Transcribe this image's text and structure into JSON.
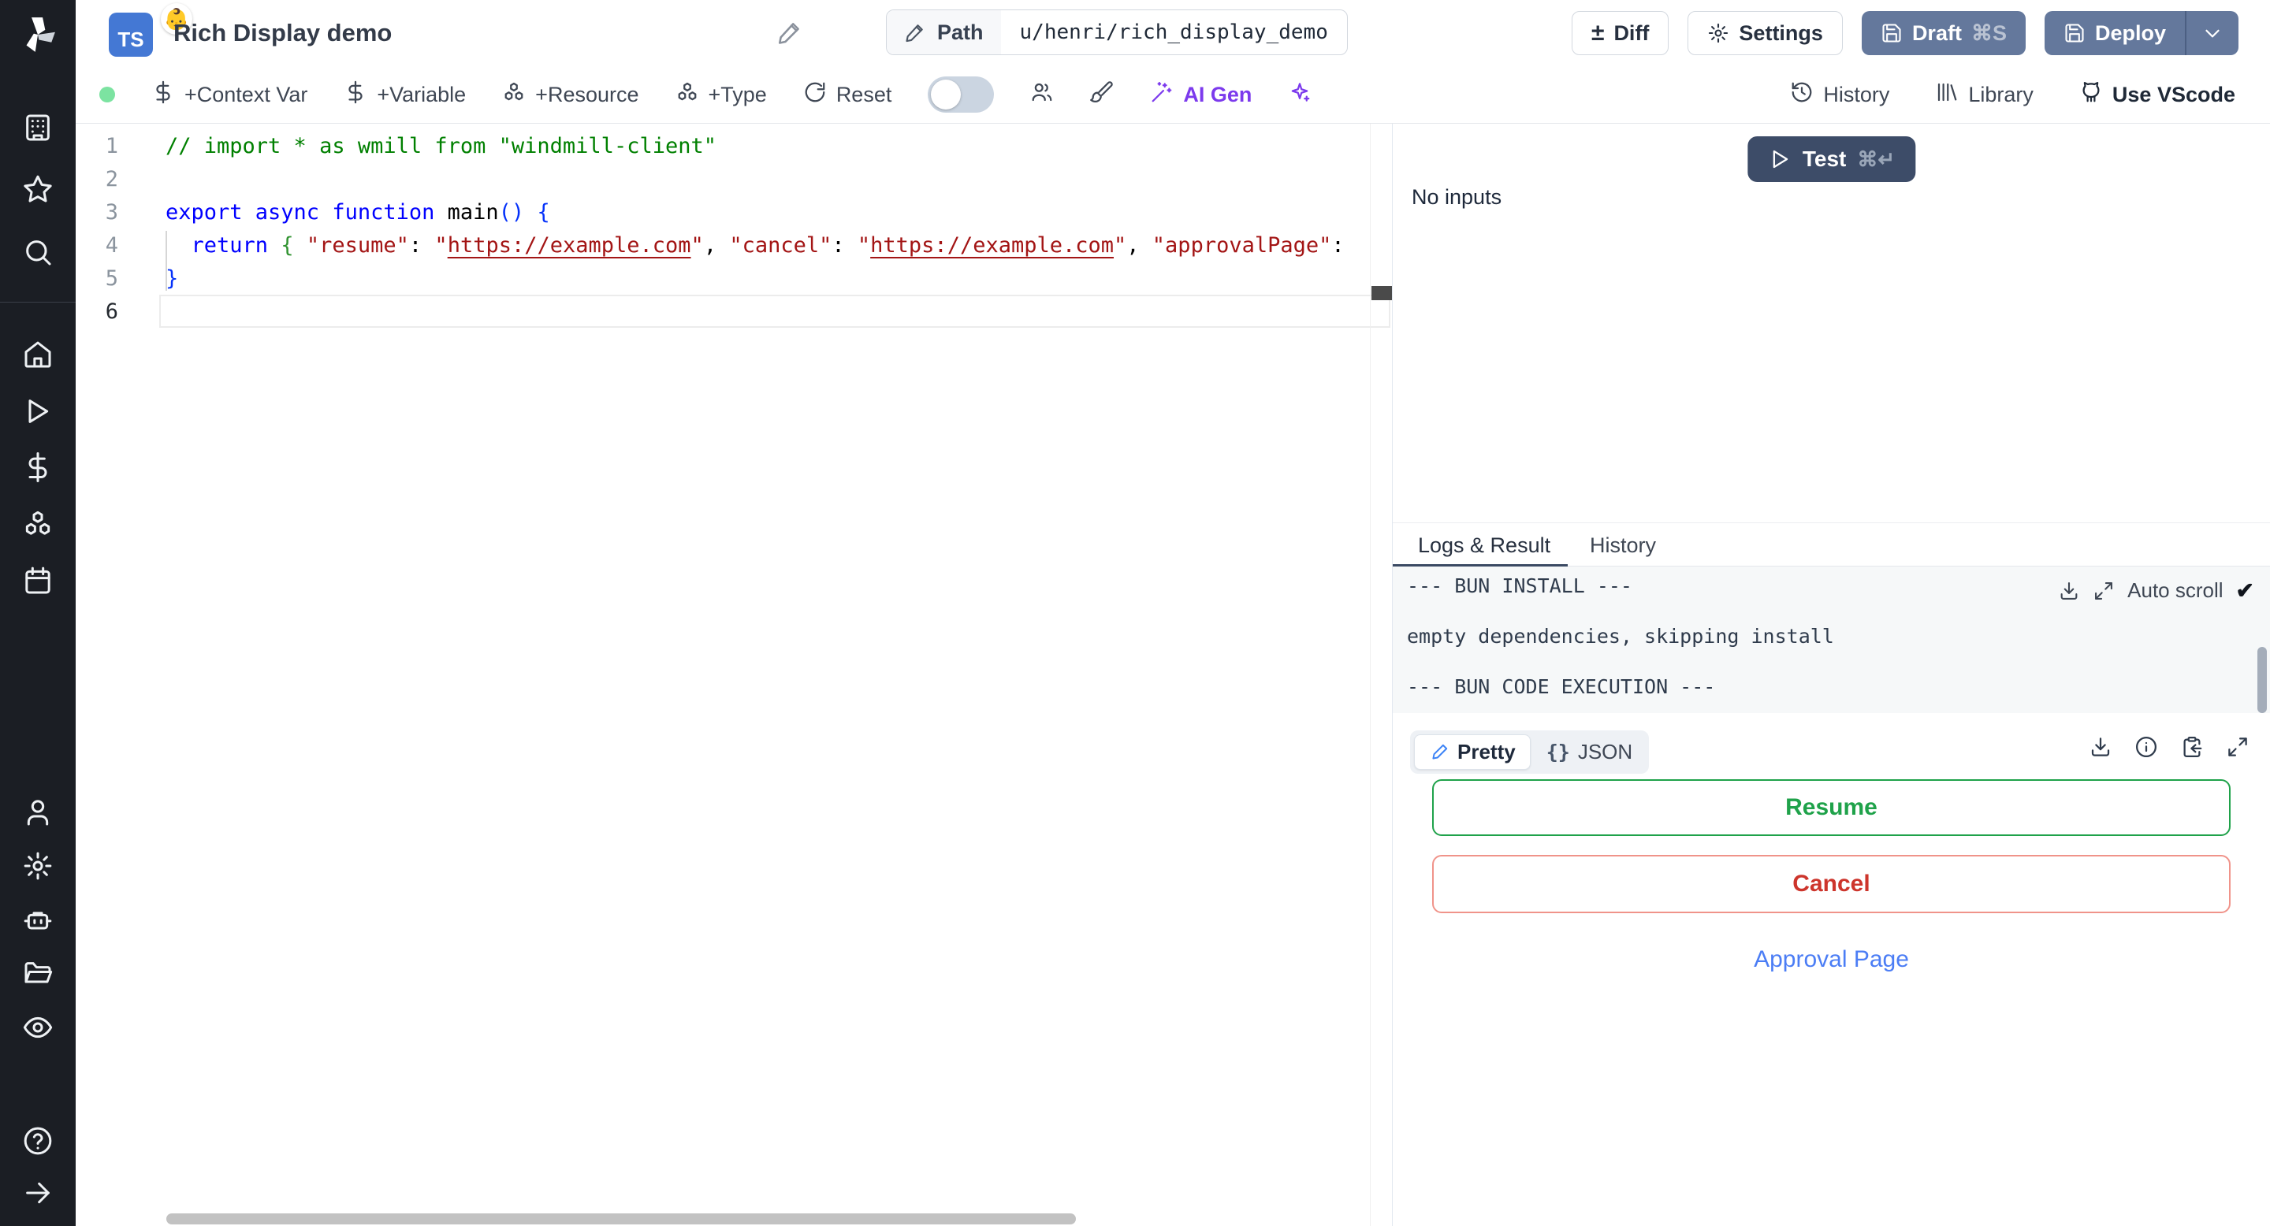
{
  "colors": {
    "accent_button": "#64789c",
    "test_button": "#3d4c68",
    "resume_green": "#1fa24a",
    "cancel_red": "#cd352c",
    "link_blue": "#4b7df5",
    "ai_purple": "#7c3aed",
    "status_dot_green": "#7ce3a1",
    "sidebar_bg": "#1b1e24",
    "ts_badge_blue": "#4478d4"
  },
  "sidebar": {
    "icons_top": [
      "building",
      "star",
      "search"
    ],
    "icons_workspace": [
      "home",
      "play",
      "dollar",
      "boxes",
      "calendar"
    ],
    "icons_admin": [
      "user",
      "settings",
      "robot",
      "folder-open",
      "eye"
    ],
    "icons_bottom": [
      "help",
      "arrow-right"
    ]
  },
  "header": {
    "ts_badge": "TS",
    "emoji": "👶",
    "title": "Rich Display demo",
    "path_label": "Path",
    "path_value": "u/henri/rich_display_demo",
    "diff_label": "Diff",
    "diff_glyph": "±",
    "settings_label": "Settings",
    "draft_label": "Draft",
    "draft_shortcut": "⌘S",
    "deploy_label": "Deploy"
  },
  "toolbar": {
    "context_var": "+Context Var",
    "variable": "+Variable",
    "resource": "+Resource",
    "type": "+Type",
    "reset": "Reset",
    "ai_gen": "AI Gen",
    "history": "History",
    "library": "Library",
    "vscode": "Use VScode"
  },
  "editor": {
    "active_line": "6",
    "lines": [
      {
        "n": "1",
        "tokens": [
          [
            "comment",
            "// import * as wmill from \"windmill-client\""
          ]
        ]
      },
      {
        "n": "2",
        "tokens": []
      },
      {
        "n": "3",
        "tokens": [
          [
            "kw",
            "export async function "
          ],
          [
            "plain",
            "main"
          ],
          [
            "b1",
            "()"
          ],
          [
            "plain",
            " "
          ],
          [
            "b1",
            "{"
          ]
        ]
      },
      {
        "n": "4",
        "tokens": [
          [
            "plain",
            "  "
          ],
          [
            "kw",
            "return"
          ],
          [
            "plain",
            " "
          ],
          [
            "b2",
            "{"
          ],
          [
            "plain",
            " "
          ],
          [
            "str",
            "\"resume\""
          ],
          [
            "plain",
            ": "
          ],
          [
            "str",
            "\""
          ],
          [
            "link",
            "https://example.com"
          ],
          [
            "str",
            "\""
          ],
          [
            "plain",
            ", "
          ],
          [
            "str",
            "\"cancel\""
          ],
          [
            "plain",
            ": "
          ],
          [
            "str",
            "\""
          ],
          [
            "link",
            "https://example.com"
          ],
          [
            "str",
            "\""
          ],
          [
            "plain",
            ", "
          ],
          [
            "str",
            "\"approvalPage\""
          ],
          [
            "plain",
            ":"
          ]
        ]
      },
      {
        "n": "5",
        "tokens": [
          [
            "b1",
            "}"
          ]
        ]
      },
      {
        "n": "6",
        "tokens": []
      }
    ]
  },
  "panel": {
    "test_label": "Test",
    "test_shortcut": "⌘↵",
    "no_inputs": "No inputs",
    "tabs": [
      "Logs & Result",
      "History"
    ],
    "auto_scroll": "Auto scroll",
    "check_glyph": "✔",
    "logs": [
      "--- BUN INSTALL ---",
      "empty dependencies, skipping install",
      "--- BUN CODE EXECUTION ---"
    ],
    "result": {
      "pretty_label": "Pretty",
      "json_label": "JSON",
      "braces_glyph": "{}",
      "resume_label": "Resume",
      "cancel_label": "Cancel",
      "approval_label": "Approval Page"
    }
  }
}
